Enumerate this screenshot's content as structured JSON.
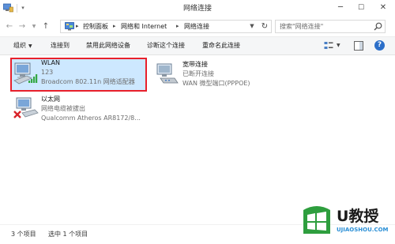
{
  "window": {
    "title": "网络连接",
    "minimize_glyph": "─",
    "maximize_glyph": "☐",
    "close_glyph": "✕"
  },
  "addressbar": {
    "back_glyph": "←",
    "forward_glyph": "→",
    "history_glyph": "▼",
    "up_glyph": "↑",
    "crumbs": [
      "控制面板",
      "网络和 Internet",
      "网络连接"
    ],
    "separator_glyph": "▸",
    "dropdown_glyph": "▼",
    "refresh_glyph": "↻",
    "search_placeholder": "搜索\"网络连接\""
  },
  "toolbar": {
    "organize": "组织",
    "organize_caret": "▼",
    "connect_to": "连接到",
    "disable": "禁用此网络设备",
    "diagnose": "诊断这个连接",
    "rename": "重命名此连接",
    "view_caret": "▼",
    "help_glyph": "?"
  },
  "connections": [
    {
      "name": "WLAN",
      "status": "123",
      "device": "Broadcom 802.11n 网络适配器",
      "icon": "wifi-adapter-icon",
      "selected": true
    },
    {
      "name": "宽带连接",
      "status": "已断开连接",
      "device": "WAN 微型端口(PPPOE)",
      "icon": "broadband-modem-icon",
      "selected": false
    },
    {
      "name": "以太网",
      "status": "网络电缆被拔出",
      "device": "Qualcomm Atheros AR8172/8...",
      "icon": "ethernet-disconnected-icon",
      "selected": false
    }
  ],
  "statusbar": {
    "item_count": "3 个项目",
    "selected_count": "选中 1 个项目"
  },
  "watermark": {
    "brand": "U教授",
    "url": "UJIAOSHOU.COM"
  },
  "colors": {
    "selection_bg": "#cde8ff",
    "highlight_border": "#e8202b",
    "toolbar_bg": "#f5f6f7",
    "watermark_green": "#2e9e3e",
    "watermark_blue": "#2a8fd6"
  }
}
